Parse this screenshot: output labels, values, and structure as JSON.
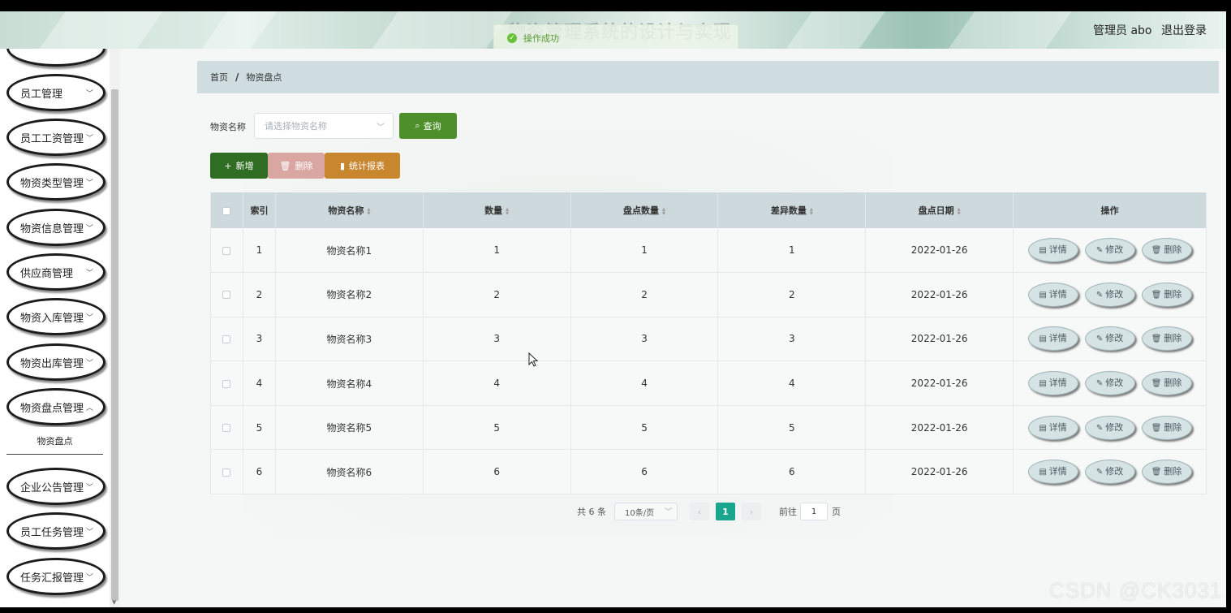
{
  "header": {
    "title": "物资管理系统的设计与实现",
    "user": "管理员 abo",
    "logout": "退出登录"
  },
  "toast": {
    "message": "操作成功"
  },
  "sidebar": {
    "items": [
      {
        "label": "员工管理"
      },
      {
        "label": "员工工资管理"
      },
      {
        "label": "物资类型管理"
      },
      {
        "label": "物资信息管理"
      },
      {
        "label": "供应商管理"
      },
      {
        "label": "物资入库管理"
      },
      {
        "label": "物资出库管理"
      },
      {
        "label": "物资盘点管理"
      },
      {
        "label": "企业公告管理"
      },
      {
        "label": "员工任务管理"
      },
      {
        "label": "任务汇报管理"
      }
    ],
    "sub_item": "物资盘点"
  },
  "breadcrumb": {
    "home": "首页",
    "current": "物资盘点"
  },
  "search": {
    "label": "物资名称",
    "placeholder": "请选择物资名称",
    "query": "查询"
  },
  "actions": {
    "add": "新增",
    "delete": "删除",
    "report": "统计报表"
  },
  "table": {
    "headers": [
      "索引",
      "物资名称",
      "数量",
      "盘点数量",
      "差异数量",
      "盘点日期",
      "操作"
    ],
    "rows": [
      [
        "1",
        "物资名称1",
        "1",
        "1",
        "1",
        "2022-01-26"
      ],
      [
        "2",
        "物资名称2",
        "2",
        "2",
        "2",
        "2022-01-26"
      ],
      [
        "3",
        "物资名称3",
        "3",
        "3",
        "3",
        "2022-01-26"
      ],
      [
        "4",
        "物资名称4",
        "4",
        "4",
        "4",
        "2022-01-26"
      ],
      [
        "5",
        "物资名称5",
        "5",
        "5",
        "5",
        "2022-01-26"
      ],
      [
        "6",
        "物资名称6",
        "6",
        "6",
        "6",
        "2022-01-26"
      ]
    ],
    "ops": {
      "detail": "详情",
      "edit": "修改",
      "delete": "删除"
    }
  },
  "pagination": {
    "total": "共 6 条",
    "page_size": "10条/页",
    "current": "1",
    "goto_label": "前往",
    "goto_value": "1",
    "page_unit": "页"
  },
  "watermark": "CSDN @CK3031"
}
